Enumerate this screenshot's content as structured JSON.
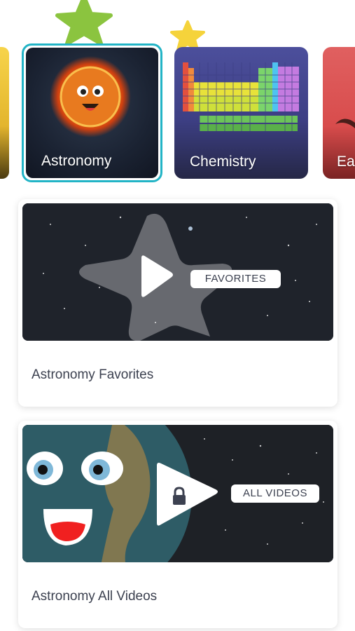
{
  "categories": [
    {
      "label": "",
      "partial": true,
      "color": "#f7d44a"
    },
    {
      "label": "Astronomy",
      "selected": true,
      "accent": "#22b4c6"
    },
    {
      "label": "Chemistry",
      "selected": false
    },
    {
      "label": "Ear",
      "partial": true,
      "color": "#e06060"
    }
  ],
  "videos": [
    {
      "title": "Astronomy Favorites",
      "tag": "FAVORITES",
      "locked": false
    },
    {
      "title": "Astronomy All Videos",
      "tag": "ALL VIDEOS",
      "locked": true
    }
  ],
  "icons": {
    "deco_star_1": "star-icon",
    "deco_star_2": "star-icon",
    "fav_play": "play-icon",
    "all_lock": "lock-icon"
  },
  "colors": {
    "selected_border": "#22b4c6",
    "star_green": "#8bc43f",
    "star_yellow": "#f5d33b",
    "title_text": "#3c4150"
  }
}
